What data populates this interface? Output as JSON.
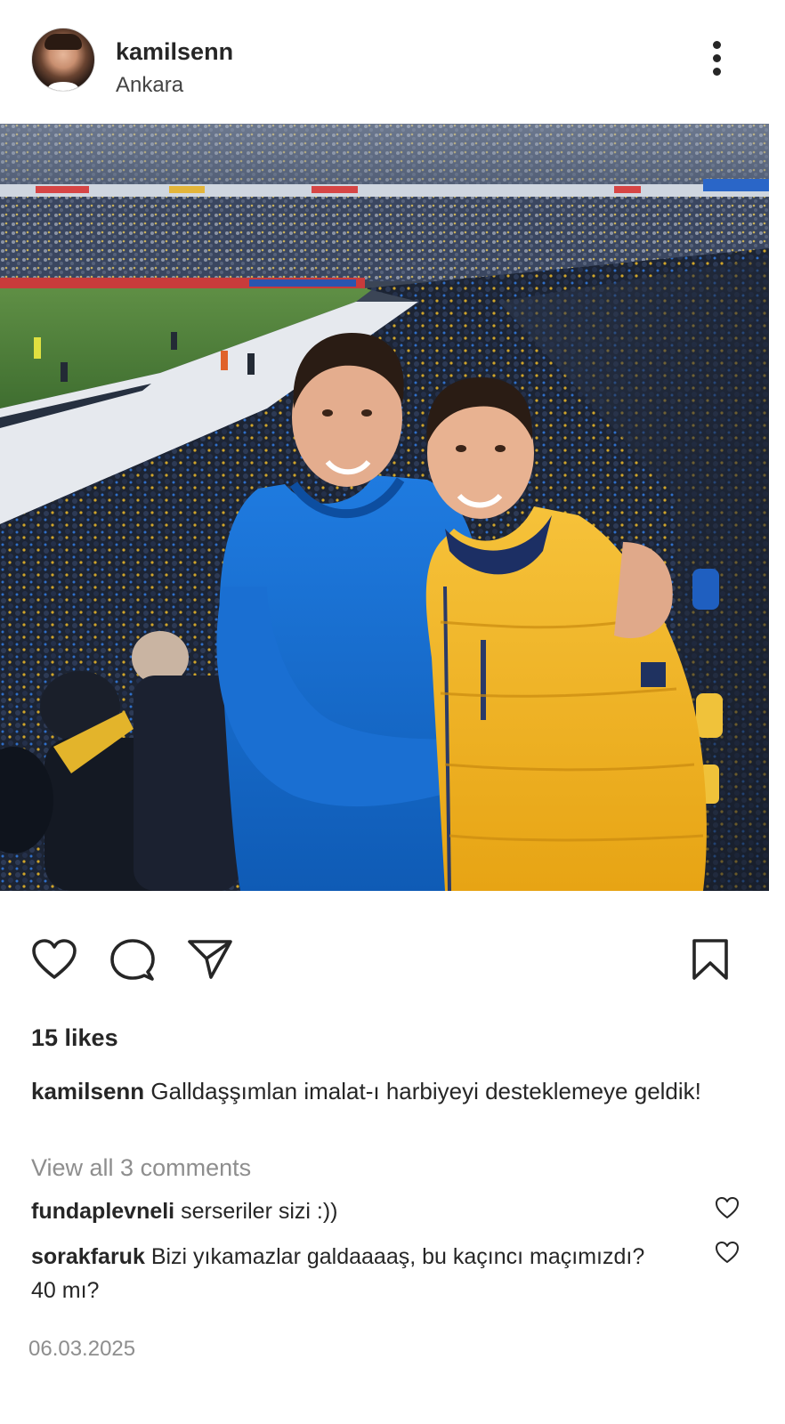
{
  "post": {
    "username": "kamilsenn",
    "location": "Ankara",
    "likes": "15 likes",
    "caption": {
      "username": "kamilsenn",
      "text": "Galldaşşımlan imalat-ı harbiyeyi desteklemeye geldik!"
    },
    "view_all_comments": "View all 3 comments",
    "comments": [
      {
        "username": "fundaplevneli",
        "text": "serseriler sizi :))"
      },
      {
        "username": "sorakfaruk",
        "text": "Bizi yıkamazlar galdaaaaş, bu kaçıncı maçımızdı? 40 mı?"
      }
    ],
    "date": "06.03.2025"
  },
  "icons": {
    "avatar": "profile-avatar",
    "more": "more-options-icon",
    "like": "heart-icon",
    "comment": "comment-bubble-icon",
    "share": "paper-plane-icon",
    "save": "bookmark-icon",
    "comment_like": "heart-icon"
  },
  "colors": {
    "text": "#262626",
    "secondary_text": "#8e8e8e",
    "blue_hoodie": "#1565c8",
    "yellow_jacket": "#f2b321"
  }
}
